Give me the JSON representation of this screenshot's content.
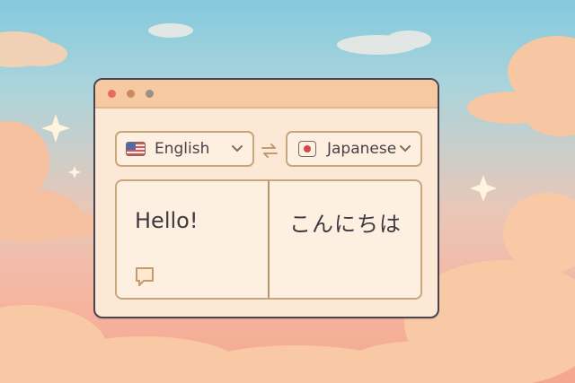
{
  "source_language": {
    "label": "English",
    "flag_icon": "us-flag-icon"
  },
  "target_language": {
    "label": "Japanese",
    "flag_icon": "japan-flag-icon"
  },
  "source_text": "Hello!",
  "translated_text": "こんにちは",
  "colors": {
    "window_bg": "#fbe9d6",
    "titlebar": "#f6c9a3",
    "border_accent": "#c9a77d",
    "close_dot": "#e46b5e",
    "minimize_dot": "#c98b5f",
    "maximize_dot": "#9c8e84"
  }
}
